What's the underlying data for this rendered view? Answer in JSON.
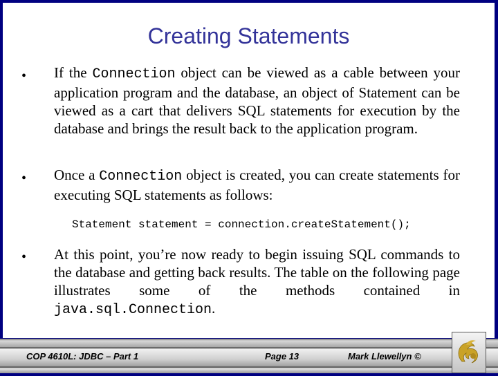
{
  "slide": {
    "title": "Creating Statements",
    "bullets": [
      {
        "symbol": "•",
        "parts": [
          "If the ",
          "Connection",
          " object can be viewed as a cable between your application program and the database, an object of Statement can be viewed as a cart that delivers SQL statements for execution by the database and brings the result back to the application program."
        ]
      },
      {
        "symbol": "•",
        "parts": [
          "Once a ",
          "Connection",
          " object is created, you can create statements for executing SQL statements as follows:"
        ]
      },
      {
        "symbol": "•",
        "parts": [
          "At this point, you’re now ready to begin issuing SQL commands to the database and getting back results.  The table on the following page illustrates some of the methods contained in ",
          "java.sql.Connection",
          "."
        ]
      }
    ],
    "code_line": "Statement statement = connection.createStatement();"
  },
  "footer": {
    "course": "COP 4610L: JDBC – Part 1",
    "page": "Page 13",
    "author": "Mark Llewellyn ©",
    "logo_icon": "pegasus-logo-icon"
  },
  "colors": {
    "border": "#000080",
    "title": "#333399",
    "logo_gold": "#c9a227"
  }
}
